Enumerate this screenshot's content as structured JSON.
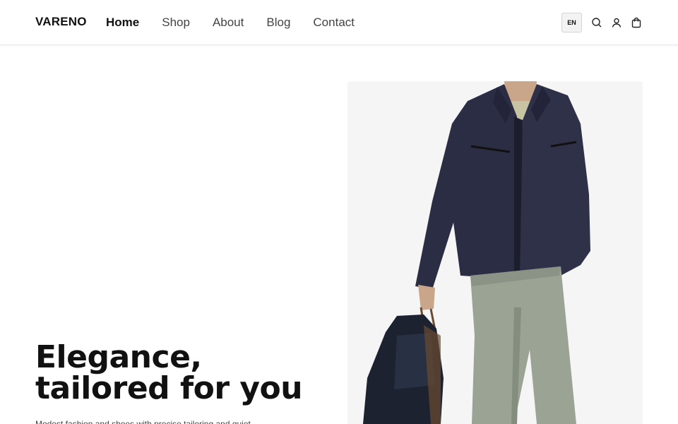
{
  "brand": {
    "name": "VARENO"
  },
  "nav": {
    "items": [
      {
        "label": "Home",
        "active": true
      },
      {
        "label": "Shop",
        "active": false
      },
      {
        "label": "About",
        "active": false
      },
      {
        "label": "Blog",
        "active": false
      },
      {
        "label": "Contact",
        "active": false
      }
    ]
  },
  "header_actions": {
    "language": "EN",
    "icons": [
      "search-icon",
      "user-icon",
      "cart-icon"
    ]
  },
  "hero": {
    "title": "Elegance, tailored for you",
    "subtitle": "Modest fashion and shoes with precise tailoring and quiet",
    "image_alt_icon": "model-photo"
  },
  "colors": {
    "text": "#111111",
    "nav_inactive": "#444444",
    "image_bg": "#f5f5f6",
    "jacket": "#2b2d45",
    "trousers": "#9aa394",
    "tshirt": "#c8c3a3"
  }
}
